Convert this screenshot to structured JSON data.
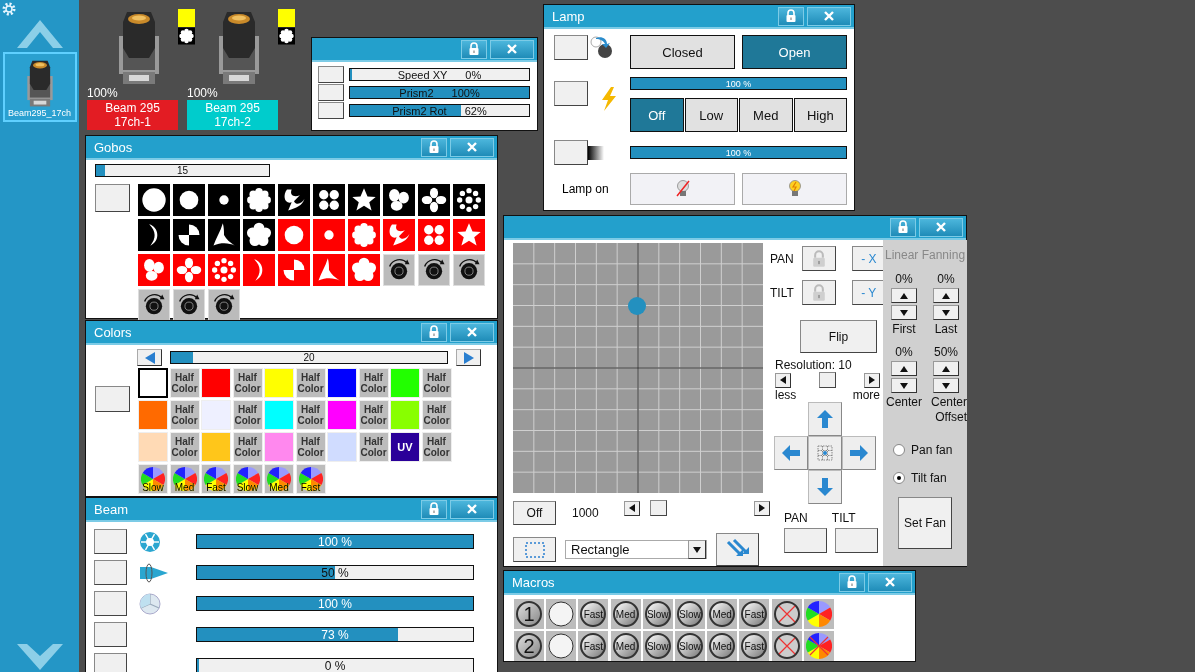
{
  "sidebar": {
    "fixture": {
      "label": "Beam295_17ch",
      "selected": true
    }
  },
  "fixtures": [
    {
      "intensity": "100%",
      "name": "Beam 295",
      "patch": "17ch-1",
      "color": "#e31c23",
      "swatch": {
        "color": "#ffff00"
      }
    },
    {
      "intensity": "100%",
      "name": "Beam 295",
      "patch": "17ch-2",
      "color": "#00cccc",
      "swatch": {
        "color": "#ffff00"
      }
    }
  ],
  "speed_window": {
    "rows": [
      {
        "label": "Speed XY",
        "reading": "0%",
        "level": 0
      },
      {
        "label": "Prism2",
        "reading": "100%",
        "level": 1
      },
      {
        "label": "Prism2 Rot",
        "reading": "62%",
        "level": 0.62
      }
    ]
  },
  "lamp": {
    "title": "Lamp",
    "shutter": [
      {
        "label": "Closed",
        "selected": false
      },
      {
        "label": "Open",
        "selected": true
      }
    ],
    "dimmer": {
      "reading": "100 %",
      "level": 1
    },
    "strobe": [
      {
        "label": "Off",
        "selected": true
      },
      {
        "label": "Low",
        "selected": false
      },
      {
        "label": "Med",
        "selected": false
      },
      {
        "label": "High",
        "selected": false
      }
    ],
    "fade": {
      "reading": "100 %",
      "level": 1
    },
    "lamp_label": "Lamp on"
  },
  "gobos": {
    "title": "Gobos",
    "slider": {
      "reading": "15",
      "level": 0.05
    },
    "items": [
      {
        "kind": "circle-large",
        "color": "#000000"
      },
      {
        "kind": "circle",
        "color": "#000000"
      },
      {
        "kind": "dot",
        "color": "#000000"
      },
      {
        "kind": "flower",
        "color": "#000000"
      },
      {
        "kind": "swirl",
        "color": "#000000"
      },
      {
        "kind": "dots",
        "color": "#000000"
      },
      {
        "kind": "star",
        "color": "#000000"
      },
      {
        "kind": "petals",
        "color": "#000000"
      },
      {
        "kind": "cross",
        "color": "#000000"
      },
      {
        "kind": "ring",
        "color": "#000000"
      },
      {
        "kind": "crescent",
        "color": "#000000"
      },
      {
        "kind": "quarters",
        "color": "#000000"
      },
      {
        "kind": "triangle",
        "color": "#000000"
      },
      {
        "kind": "blossom",
        "color": "#000000"
      },
      {
        "kind": "circle",
        "color": "#ff0000"
      },
      {
        "kind": "dot",
        "color": "#ff0000"
      },
      {
        "kind": "flower",
        "color": "#ff0000"
      },
      {
        "kind": "swirl",
        "color": "#ff0000"
      },
      {
        "kind": "dots",
        "color": "#ff0000"
      },
      {
        "kind": "star",
        "color": "#ff0000"
      },
      {
        "kind": "petals",
        "color": "#ff0000"
      },
      {
        "kind": "cross",
        "color": "#ff0000"
      },
      {
        "kind": "ring",
        "color": "#ff0000"
      },
      {
        "kind": "crescent",
        "color": "#ff0000"
      },
      {
        "kind": "quarters",
        "color": "#ff0000"
      },
      {
        "kind": "triangle",
        "color": "#ff0000"
      },
      {
        "kind": "blossom",
        "color": "#ff0000"
      },
      {
        "kind": "spin",
        "color": "#bbbbbb"
      },
      {
        "kind": "spin",
        "color": "#bbbbbb"
      },
      {
        "kind": "spin",
        "color": "#bbbbbb"
      },
      {
        "kind": "spin",
        "color": "#bbbbbb"
      },
      {
        "kind": "spin",
        "color": "#bbbbbb"
      },
      {
        "kind": "spin",
        "color": "#bbbbbb"
      }
    ]
  },
  "colors": {
    "title": "Colors",
    "slider": {
      "reading": "20",
      "level": 0.08
    },
    "items": [
      {
        "kind": "swatch",
        "color": "#ffffff",
        "selected": true
      },
      {
        "kind": "half",
        "label": "Half Color",
        "selected": false
      },
      {
        "kind": "swatch",
        "color": "#ff0000",
        "selected": false
      },
      {
        "kind": "half",
        "label": "Half Color",
        "selected": false
      },
      {
        "kind": "swatch",
        "color": "#ffff00",
        "selected": false
      },
      {
        "kind": "half",
        "label": "Half Color",
        "selected": false
      },
      {
        "kind": "swatch",
        "color": "#0000ff",
        "selected": false
      },
      {
        "kind": "half",
        "label": "Half Color",
        "selected": false
      },
      {
        "kind": "swatch",
        "color": "#22ff00",
        "selected": false
      },
      {
        "kind": "half",
        "label": "Half Color",
        "selected": false
      },
      {
        "kind": "swatch",
        "color": "#ff6a00",
        "selected": false
      },
      {
        "kind": "half",
        "label": "Half Color",
        "selected": false
      },
      {
        "kind": "swatch",
        "color": "#eef0ff",
        "selected": false
      },
      {
        "kind": "half",
        "label": "Half Color",
        "selected": false
      },
      {
        "kind": "swatch",
        "color": "#00ffff",
        "selected": false
      },
      {
        "kind": "half",
        "label": "Half Color",
        "selected": false
      },
      {
        "kind": "swatch",
        "color": "#ff00ff",
        "selected": false
      },
      {
        "kind": "half",
        "label": "Half Color",
        "selected": false
      },
      {
        "kind": "swatch",
        "color": "#88ff00",
        "selected": false
      },
      {
        "kind": "half",
        "label": "Half Color",
        "selected": false
      },
      {
        "kind": "swatch",
        "color": "#ffdab5",
        "selected": false
      },
      {
        "kind": "half",
        "label": "Half Color",
        "selected": false
      },
      {
        "kind": "swatch",
        "color": "#ffc61a",
        "selected": false
      },
      {
        "kind": "half",
        "label": "Half Color",
        "selected": false
      },
      {
        "kind": "swatch",
        "color": "#ff88ee",
        "selected": false
      },
      {
        "kind": "half",
        "label": "Half Color",
        "selected": false
      },
      {
        "kind": "swatch",
        "color": "#d0dcff",
        "selected": false
      },
      {
        "kind": "half",
        "label": "Half Color",
        "selected": false
      },
      {
        "kind": "swatch",
        "color": "#2a0099",
        "label": "UV",
        "selected": false
      },
      {
        "kind": "half",
        "label": "Half Color",
        "selected": false
      },
      {
        "kind": "wheel",
        "label": "Slow",
        "selected": false
      },
      {
        "kind": "wheel",
        "label": "Med",
        "selected": false
      },
      {
        "kind": "wheel",
        "label": "Fast",
        "selected": false
      },
      {
        "kind": "wheel",
        "label": "Slow",
        "selected": false
      },
      {
        "kind": "wheel",
        "label": "Med",
        "selected": false
      },
      {
        "kind": "wheel",
        "label": "Fast",
        "selected": false
      }
    ]
  },
  "beam": {
    "title": "Beam",
    "rows": [
      {
        "kind": "iris",
        "reading": "100 %",
        "level": 1
      },
      {
        "kind": "zoom",
        "reading": "50 %",
        "level": 0.5
      },
      {
        "kind": "frost",
        "reading": "100 %",
        "level": 1
      },
      {
        "kind": "plain",
        "reading": "73 %",
        "level": 0.73
      },
      {
        "kind": "plain",
        "reading": "0 %",
        "level": 0
      }
    ]
  },
  "position": {
    "pan_label": "PAN",
    "tilt_label": "TILT",
    "invert_x": "- X",
    "invert_y": "- Y",
    "flip": "Flip",
    "resolution": "Resolution: 10",
    "less": "less",
    "more": "more",
    "effect_toggle": "Off",
    "speed_value": "1000",
    "shape": "Rectangle",
    "pan_button_label": "PAN",
    "tilt_button_label": "TILT",
    "fanning": {
      "title": "Linear Fanning",
      "spinners": [
        {
          "reading": "0%",
          "label": "First"
        },
        {
          "reading": "0%",
          "label": "Last"
        },
        {
          "reading": "0%",
          "label": "Center"
        },
        {
          "reading": "50%",
          "label": "Center Offset"
        }
      ],
      "modes": [
        {
          "label": "Pan fan",
          "selected": false
        },
        {
          "label": "Tilt fan",
          "selected": true
        }
      ],
      "set_button": "Set Fan"
    }
  },
  "macros": {
    "title": "Macros",
    "rows": [
      [
        {
          "kind": "number",
          "label": "1"
        },
        {
          "kind": "blank"
        },
        {
          "kind": "spin",
          "label": "Fast"
        },
        {
          "kind": "spin",
          "label": "Med"
        },
        {
          "kind": "spin",
          "label": "Slow"
        },
        {
          "kind": "spin",
          "label": "Slow"
        },
        {
          "kind": "spin",
          "label": "Med"
        },
        {
          "kind": "spin",
          "label": "Fast"
        },
        {
          "kind": "cancel"
        },
        {
          "kind": "rainbow"
        }
      ],
      [
        {
          "kind": "number",
          "label": "2"
        },
        {
          "kind": "blank"
        },
        {
          "kind": "spin",
          "label": "Fast"
        },
        {
          "kind": "spin",
          "label": "Med"
        },
        {
          "kind": "spin",
          "label": "Slow"
        },
        {
          "kind": "spin",
          "label": "Slow"
        },
        {
          "kind": "spin",
          "label": "Med"
        },
        {
          "kind": "spin",
          "label": "Fast"
        },
        {
          "kind": "cancel"
        },
        {
          "kind": "rainbow-off"
        }
      ]
    ]
  }
}
